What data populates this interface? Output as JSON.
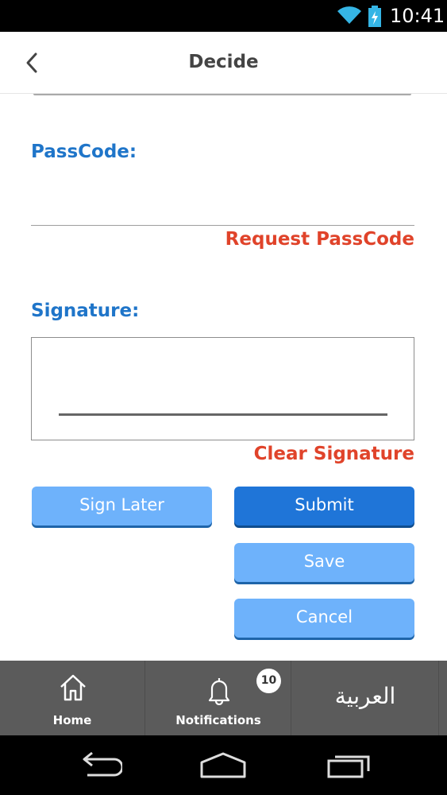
{
  "status_bar": {
    "time": "10:41"
  },
  "header": {
    "title": "Decide"
  },
  "form": {
    "passcode_label": "PassCode:",
    "passcode_value": "",
    "request_passcode": "Request PassCode",
    "signature_label": "Signature:",
    "clear_signature": "Clear Signature"
  },
  "buttons": {
    "sign_later": "Sign Later",
    "submit": "Submit",
    "save": "Save",
    "cancel": "Cancel"
  },
  "bottom_nav": {
    "home": "Home",
    "notifications": "Notifications",
    "notifications_count": "10",
    "language": "العربية"
  },
  "colors": {
    "label_blue": "#1f75c9",
    "link_red": "#e0432a",
    "button_light": "#6eb2fb",
    "button_dark": "#1f75d8",
    "nav_bg": "#5b5b5b"
  },
  "icons": {
    "wifi": "wifi-icon",
    "battery": "battery-charging-icon",
    "back": "chevron-left-icon",
    "home": "house-icon",
    "notifications": "bell-icon",
    "system_back": "back-arrow-icon",
    "system_home": "home-outline-icon",
    "system_recent": "recent-apps-icon"
  }
}
